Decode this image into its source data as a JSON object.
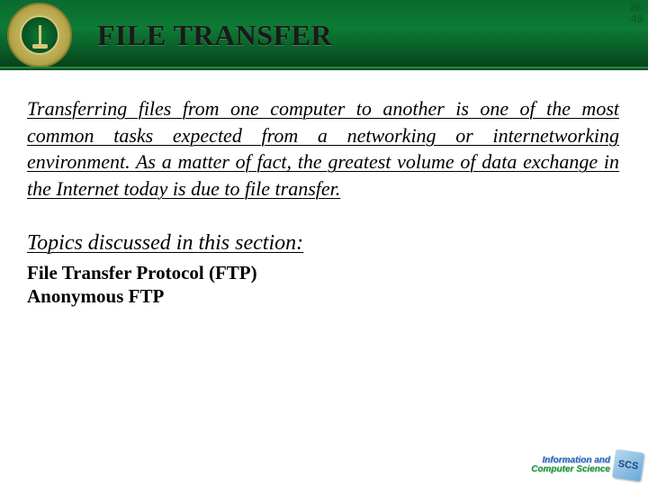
{
  "header": {
    "title": "FILE TRANSFER"
  },
  "page_number": {
    "top": "26.",
    "bottom": "49"
  },
  "intro": "Transferring files from one computer to another is one of the most common tasks expected from a networking or internetworking environment. As a matter of fact, the greatest volume of data exchange in the Internet today is due to file transfer.",
  "topics": {
    "heading": "Topics discussed in this section:",
    "items": [
      "File Transfer Protocol (FTP)",
      "Anonymous FTP"
    ]
  },
  "footer": {
    "line1": "Information and",
    "line2": "Computer Science",
    "badge": "SCS"
  }
}
